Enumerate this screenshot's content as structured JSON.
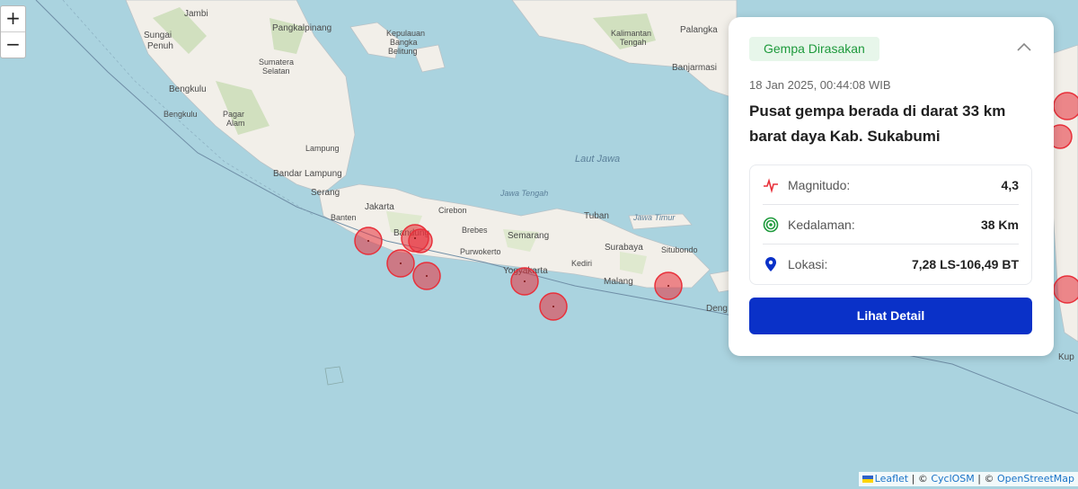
{
  "map": {
    "places": {
      "jambi": "Jambi",
      "sungai_penuh": "Sungai\nPenuh",
      "pangkalpinang": "Pangkalpinang",
      "bangka_belitung": "Kepulauan\nBangka\nBelitung",
      "bengkulu": "Bengkulu",
      "bengkulu_prov": "Bengkulu",
      "sumatera_selatan": "Sumatera\nSelatan",
      "pagar_alam": "Pagar\nAlam",
      "lampung": "Lampung",
      "bandar_lampung": "Bandar Lampung",
      "serang": "Serang",
      "banten": "Banten",
      "jakarta": "Jakarta",
      "bandung": "Bandung",
      "cirebon": "Cirebon",
      "brebes": "Brebes",
      "semarang": "Semarang",
      "purwokerto": "Purwokerto",
      "yogyakarta": "Yogyakarta",
      "jawa_tengah": "Jawa Tengah",
      "tuban": "Tuban",
      "jawa_timur": "Jawa Timur",
      "surabaya": "Surabaya",
      "situbondo": "Situbondo",
      "kediri": "Kediri",
      "malang": "Malang",
      "denpasar": "Deng",
      "palangka": "Palangka",
      "kalimantan_tengah": "Kalimantan\nTengah",
      "banjarmasin": "Banjarmasi",
      "kupang": "Kup",
      "laut_jawa": "Laut Jawa"
    },
    "zoom_in": "+",
    "zoom_out": "−"
  },
  "attribution": {
    "leaflet": "Leaflet",
    "sep1": " | © ",
    "cyclosm": "CyclOSM",
    "sep2": " | © ",
    "osm": "OpenStreetMap"
  },
  "card": {
    "badge": "Gempa Dirasakan",
    "datetime": "18 Jan 2025, 00:44:08 WIB",
    "title": "Pusat gempa berada di darat 33 km barat daya Kab. Sukabumi",
    "rows": [
      {
        "icon": "pulse-icon",
        "label": "Magnitudo:",
        "value": "4,3"
      },
      {
        "icon": "depth-icon",
        "label": "Kedalaman:",
        "value": "38 Km"
      },
      {
        "icon": "location-pin-icon",
        "label": "Lokasi:",
        "value": "7,28 LS-106,49 BT"
      }
    ],
    "button": "Lihat Detail"
  },
  "colors": {
    "sea": "#aad3df",
    "land": "#f2efe9",
    "quake_marker": "#e8303a",
    "badge_bg": "#e7f6ea",
    "badge_text": "#1e9a3c",
    "button": "#0a31c8"
  }
}
